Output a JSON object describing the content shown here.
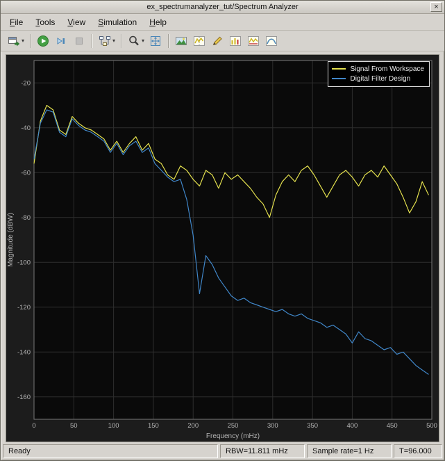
{
  "window": {
    "title": "ex_spectrumanalyzer_tut/Spectrum Analyzer",
    "close_glyph": "×"
  },
  "menu": {
    "items": [
      {
        "label": "File"
      },
      {
        "label": "Tools"
      },
      {
        "label": "View"
      },
      {
        "label": "Simulation"
      },
      {
        "label": "Help"
      }
    ]
  },
  "toolbar": {
    "buttons": [
      {
        "name": "export",
        "icon": "export-icon",
        "has_dropdown": true
      },
      {
        "name": "run",
        "icon": "play-icon",
        "has_dropdown": false
      },
      {
        "name": "step-forward",
        "icon": "step-forward-icon",
        "has_dropdown": false
      },
      {
        "name": "stop",
        "icon": "stop-icon",
        "has_dropdown": false,
        "disabled": true
      },
      {
        "name": "simulation-settings",
        "icon": "blocks-icon",
        "has_dropdown": true
      },
      {
        "name": "zoom",
        "icon": "magnifier-icon",
        "has_dropdown": true
      },
      {
        "name": "fit-to-view",
        "icon": "fit-to-view-icon",
        "has_dropdown": false
      },
      {
        "name": "spectrum-settings",
        "icon": "image-icon",
        "has_dropdown": false
      },
      {
        "name": "measurements",
        "icon": "measurements-icon",
        "has_dropdown": false
      },
      {
        "name": "peak-finder",
        "icon": "pencil-icon",
        "has_dropdown": false
      },
      {
        "name": "distortion-measurements",
        "icon": "bars-icon",
        "has_dropdown": false
      },
      {
        "name": "channel-measurements",
        "icon": "channel-icon",
        "has_dropdown": false
      },
      {
        "name": "spectral-mask",
        "icon": "curve-icon",
        "has_dropdown": false
      }
    ]
  },
  "chart_data": {
    "type": "line",
    "title": "",
    "xlabel": "Frequency (mHz)",
    "ylabel": "Magnitude (dBW)",
    "xlim": [
      0,
      500
    ],
    "ylim": [
      -170,
      -10
    ],
    "xticks": [
      0,
      50,
      100,
      150,
      200,
      250,
      300,
      350,
      400,
      450,
      500
    ],
    "yticks": [
      -20,
      -40,
      -60,
      -80,
      -100,
      -120,
      -140,
      -160
    ],
    "grid": true,
    "legend_position": "top-right",
    "colors": {
      "plot_bg": "#0a0a0a",
      "figure_bg": "#1c1c1c",
      "grid": "#2e2e2e",
      "frame": "#787878",
      "tick_text": "#b5b5b5"
    },
    "x": [
      0,
      8,
      16,
      24,
      32,
      40,
      48,
      56,
      64,
      72,
      80,
      88,
      96,
      104,
      112,
      120,
      128,
      136,
      144,
      152,
      160,
      168,
      176,
      184,
      192,
      200,
      208,
      216,
      224,
      232,
      240,
      248,
      256,
      264,
      272,
      280,
      288,
      296,
      304,
      312,
      320,
      328,
      336,
      344,
      352,
      360,
      368,
      376,
      384,
      392,
      400,
      408,
      416,
      424,
      432,
      440,
      448,
      456,
      464,
      472,
      480,
      488,
      496
    ],
    "series": [
      {
        "name": "Signal From Workspace",
        "color": "#e3e04e",
        "values": [
          -56,
          -37,
          -30,
          -32,
          -41,
          -43,
          -35,
          -38,
          -40,
          -41,
          -43,
          -45,
          -50,
          -46,
          -51,
          -47,
          -44,
          -50,
          -47,
          -54,
          -56,
          -61,
          -63,
          -57,
          -59,
          -63,
          -66,
          -59,
          -61,
          -67,
          -60,
          -63,
          -61,
          -64,
          -67,
          -71,
          -74,
          -80,
          -70,
          -64,
          -61,
          -64,
          -59,
          -57,
          -61,
          -66,
          -71,
          -66,
          -61,
          -59,
          -62,
          -66,
          -61,
          -59,
          -62,
          -57,
          -61,
          -65,
          -71,
          -78,
          -73,
          -64,
          -70
        ]
      },
      {
        "name": "Digital Filter Design",
        "color": "#4086c8",
        "values": [
          -54,
          -38,
          -32,
          -33,
          -42,
          -44,
          -36,
          -39,
          -41,
          -42,
          -44,
          -46,
          -51,
          -47,
          -52,
          -48,
          -46,
          -51,
          -49,
          -56,
          -59,
          -62,
          -64,
          -63,
          -72,
          -88,
          -114,
          -97,
          -101,
          -107,
          -111,
          -115,
          -117,
          -116,
          -118,
          -119,
          -120,
          -121,
          -122,
          -121,
          -123,
          -124,
          -123,
          -125,
          -126,
          -127,
          -129,
          -128,
          -130,
          -132,
          -136,
          -131,
          -134,
          -135,
          -137,
          -139,
          -138,
          -141,
          -140,
          -143,
          -146,
          -148,
          -150
        ]
      }
    ]
  },
  "status": {
    "ready": "Ready",
    "rbw": "RBW=11.811 mHz",
    "sample_rate": "Sample rate=1 Hz",
    "time": "T=96.000"
  }
}
